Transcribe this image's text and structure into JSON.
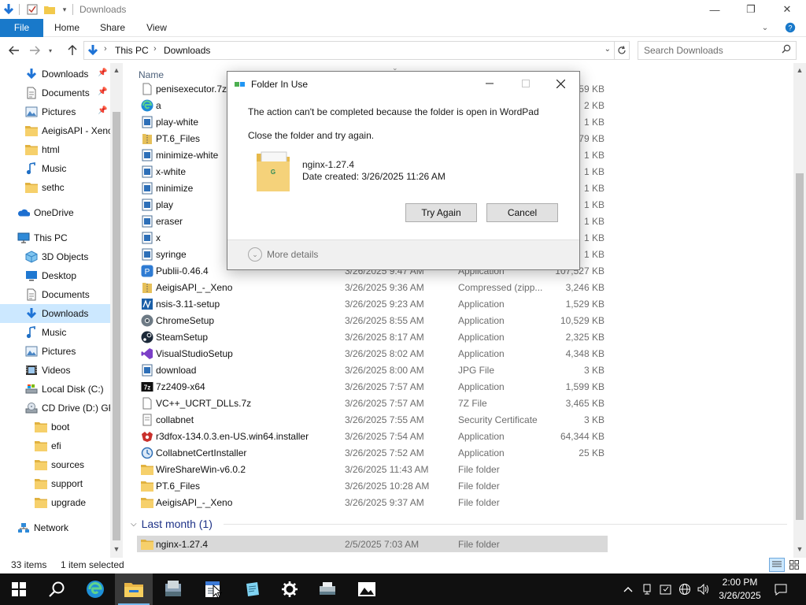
{
  "window": {
    "title": "Downloads",
    "controls": {
      "minimize": "—",
      "maximize": "❐",
      "close": "✕"
    }
  },
  "ribbon": {
    "tabs": [
      "File",
      "Home",
      "Share",
      "View"
    ],
    "help": "?"
  },
  "address": {
    "crumbs": [
      "This PC",
      "Downloads"
    ],
    "search_placeholder": "Search Downloads"
  },
  "nav": {
    "items": [
      {
        "label": "Downloads",
        "icon": "download-icon",
        "pinned": true
      },
      {
        "label": "Documents",
        "icon": "documents-icon",
        "pinned": true
      },
      {
        "label": "Pictures",
        "icon": "pictures-icon",
        "pinned": true
      },
      {
        "label": "AeigisAPI - Xeno",
        "icon": "folder-icon",
        "pinned": false
      },
      {
        "label": "html",
        "icon": "folder-icon",
        "pinned": false
      },
      {
        "label": "Music",
        "icon": "music-icon",
        "pinned": false
      },
      {
        "label": "sethc",
        "icon": "folder-icon",
        "pinned": false
      },
      {
        "label": "OneDrive",
        "icon": "onedrive-icon",
        "pinned": false
      },
      {
        "label": "This PC",
        "icon": "this-pc-icon",
        "pinned": false
      },
      {
        "label": "3D Objects",
        "icon": "3d-objects-icon",
        "pinned": false
      },
      {
        "label": "Desktop",
        "icon": "desktop-icon",
        "pinned": false
      },
      {
        "label": "Documents",
        "icon": "documents-icon",
        "pinned": false
      },
      {
        "label": "Downloads",
        "icon": "download-icon",
        "pinned": false,
        "selected": true
      },
      {
        "label": "Music",
        "icon": "music-icon",
        "pinned": false
      },
      {
        "label": "Pictures",
        "icon": "pictures-icon",
        "pinned": false
      },
      {
        "label": "Videos",
        "icon": "videos-icon",
        "pinned": false
      },
      {
        "label": "Local Disk (C:)",
        "icon": "local-disk-icon",
        "pinned": false
      },
      {
        "label": "CD Drive (D:) GR",
        "icon": "cd-drive-icon",
        "pinned": false
      },
      {
        "label": "boot",
        "icon": "folder-icon",
        "pinned": false
      },
      {
        "label": "efi",
        "icon": "folder-icon",
        "pinned": false
      },
      {
        "label": "sources",
        "icon": "folder-icon",
        "pinned": false
      },
      {
        "label": "support",
        "icon": "folder-icon",
        "pinned": false
      },
      {
        "label": "upgrade",
        "icon": "folder-icon",
        "pinned": false
      },
      {
        "label": "Network",
        "icon": "network-icon",
        "pinned": false
      }
    ]
  },
  "filelist": {
    "columns": {
      "name": "Name"
    },
    "rows": [
      {
        "name": "penisexecutor.7z",
        "date": "",
        "type": "",
        "size": "...59 KB",
        "icon": "archive-icon"
      },
      {
        "name": "a",
        "date": "",
        "type": "",
        "size": "2 KB",
        "icon": "edge-icon"
      },
      {
        "name": "play-white",
        "date": "",
        "type": "",
        "size": "1 KB",
        "icon": "image-icon"
      },
      {
        "name": "PT.6_Files",
        "date": "",
        "type": "",
        "size": "...379 KB",
        "icon": "zip-icon"
      },
      {
        "name": "minimize-white",
        "date": "",
        "type": "",
        "size": "1 KB",
        "icon": "image-icon"
      },
      {
        "name": "x-white",
        "date": "",
        "type": "",
        "size": "1 KB",
        "icon": "image-icon"
      },
      {
        "name": "minimize",
        "date": "",
        "type": "",
        "size": "1 KB",
        "icon": "image-icon"
      },
      {
        "name": "play",
        "date": "",
        "type": "",
        "size": "1 KB",
        "icon": "image-icon"
      },
      {
        "name": "eraser",
        "date": "",
        "type": "",
        "size": "1 KB",
        "icon": "image-icon"
      },
      {
        "name": "x",
        "date": "",
        "type": "",
        "size": "1 KB",
        "icon": "image-icon"
      },
      {
        "name": "syringe",
        "date": "",
        "type": "",
        "size": "1 KB",
        "icon": "image-icon"
      },
      {
        "name": "Publii-0.46.4",
        "date": "3/26/2025 9:47 AM",
        "type": "Application",
        "size": "107,527 KB",
        "icon": "publii-icon"
      },
      {
        "name": "AeigisAPI_-_Xeno",
        "date": "3/26/2025 9:36 AM",
        "type": "Compressed (zipp...",
        "size": "3,246 KB",
        "icon": "zip-icon"
      },
      {
        "name": "nsis-3.11-setup",
        "date": "3/26/2025 9:23 AM",
        "type": "Application",
        "size": "1,529 KB",
        "icon": "installer-icon"
      },
      {
        "name": "ChromeSetup",
        "date": "3/26/2025 8:55 AM",
        "type": "Application",
        "size": "10,529 KB",
        "icon": "chrome-icon"
      },
      {
        "name": "SteamSetup",
        "date": "3/26/2025 8:17 AM",
        "type": "Application",
        "size": "2,325 KB",
        "icon": "steam-icon"
      },
      {
        "name": "VisualStudioSetup",
        "date": "3/26/2025 8:02 AM",
        "type": "Application",
        "size": "4,348 KB",
        "icon": "visual-studio-icon"
      },
      {
        "name": "download",
        "date": "3/26/2025 8:00 AM",
        "type": "JPG File",
        "size": "3 KB",
        "icon": "image-icon"
      },
      {
        "name": "7z2409-x64",
        "date": "3/26/2025 7:57 AM",
        "type": "Application",
        "size": "1,599 KB",
        "icon": "7zip-icon"
      },
      {
        "name": "VC++_UCRT_DLLs.7z",
        "date": "3/26/2025 7:57 AM",
        "type": "7Z File",
        "size": "3,465 KB",
        "icon": "archive-icon"
      },
      {
        "name": "collabnet",
        "date": "3/26/2025 7:55 AM",
        "type": "Security Certificate",
        "size": "3 KB",
        "icon": "certificate-icon"
      },
      {
        "name": "r3dfox-134.0.3.en-US.win64.installer",
        "date": "3/26/2025 7:54 AM",
        "type": "Application",
        "size": "64,344 KB",
        "icon": "r3dfox-icon"
      },
      {
        "name": "CollabnetCertInstaller",
        "date": "3/26/2025 7:52 AM",
        "type": "Application",
        "size": "25 KB",
        "icon": "cert-installer-icon"
      },
      {
        "name": "WireShareWin-v6.0.2",
        "date": "3/26/2025 11:43 AM",
        "type": "File folder",
        "size": "",
        "icon": "folder-icon"
      },
      {
        "name": "PT.6_Files",
        "date": "3/26/2025 10:28 AM",
        "type": "File folder",
        "size": "",
        "icon": "folder-icon"
      },
      {
        "name": "AeigisAPI_-_Xeno",
        "date": "3/26/2025 9:37 AM",
        "type": "File folder",
        "size": "",
        "icon": "folder-icon"
      }
    ],
    "group_last_month": "Last month (1)",
    "last_month_rows": [
      {
        "name": "nginx-1.27.4",
        "date": "2/5/2025 7:03 AM",
        "type": "File folder",
        "size": "",
        "icon": "folder-icon",
        "selected": true
      }
    ]
  },
  "status": {
    "items_count": "33 items",
    "selection": "1 item selected"
  },
  "dialog": {
    "title": "Folder In Use",
    "message": "The action can't be completed because the folder is open in WordPad",
    "instruction": "Close the folder and try again.",
    "file_name": "nginx-1.27.4",
    "file_date": "Date created: 3/26/2025 11:26 AM",
    "try_again": "Try Again",
    "cancel": "Cancel",
    "more_details": "More details"
  },
  "taskbar": {
    "apps": [
      "start-icon",
      "search-icon",
      "edge-icon",
      "file-explorer-icon",
      "app-installer-icon",
      "wordpad-icon",
      "notepad-icon",
      "settings-icon",
      "network-drive-icon",
      "photos-icon"
    ],
    "active_app": "file-explorer-icon",
    "clock_time": "2:00 PM",
    "clock_date": "3/26/2025"
  },
  "colors": {
    "accent": "#1979ca",
    "selection": "#cce8ff",
    "taskbar": "#101010"
  }
}
